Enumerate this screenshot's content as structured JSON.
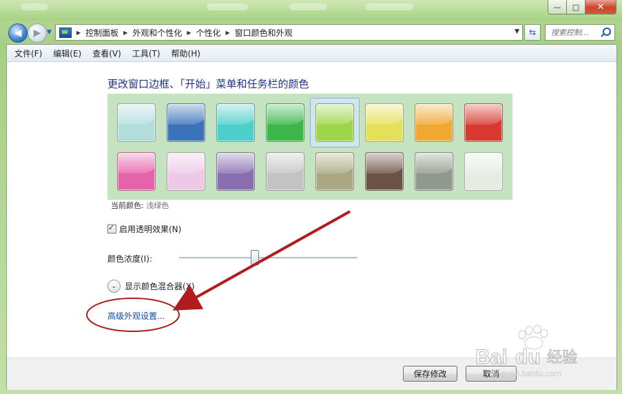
{
  "window": {
    "caption_buttons": {
      "minimize": "—",
      "maximize": "□",
      "close": "✕"
    }
  },
  "address": {
    "breadcrumbs": [
      "控制面板",
      "外观和个性化",
      "个性化",
      "窗口颜色和外观"
    ],
    "search_placeholder": "搜索控制..."
  },
  "icons": {
    "back": "back-arrow-icon",
    "forward": "forward-arrow-icon",
    "refresh": "refresh-icon",
    "search": "search-icon",
    "control_panel": "control-panel-icon",
    "expand": "chevron-down-icon"
  },
  "menu": [
    "文件(F)",
    "编辑(E)",
    "查看(V)",
    "工具(T)",
    "帮助(H)"
  ],
  "main": {
    "heading": "更改窗口边框、「开始」菜单和任务栏的颜色",
    "swatches": [
      {
        "color": "#b3dcdc"
      },
      {
        "color": "#3a73b8"
      },
      {
        "color": "#4dcfcb"
      },
      {
        "color": "#3cb549"
      },
      {
        "color": "#9ed64a",
        "selected": true
      },
      {
        "color": "#e5e05a"
      },
      {
        "color": "#f0a832"
      },
      {
        "color": "#d93a30"
      },
      {
        "color": "#e563a8"
      },
      {
        "color": "#ecc9e6"
      },
      {
        "color": "#8a6fb0"
      },
      {
        "color": "#c3c3c3"
      },
      {
        "color": "#a9a882"
      },
      {
        "color": "#6b5246"
      },
      {
        "color": "#8f9a8c"
      },
      {
        "color": "#e6ebe3"
      }
    ],
    "current_color_label": "当前颜色:",
    "current_color_value": "浅绿色",
    "transparency_label": "启用透明效果(N)",
    "transparency_checked": true,
    "intensity_label": "颜色浓度(I):",
    "intensity_value": 0.42,
    "mixer_label": "显示颜色混合器(X)",
    "advanced_link": "高级外观设置..."
  },
  "footer": {
    "save": "保存修改",
    "cancel": "取消"
  },
  "annotation": {
    "color": "#b01c1c"
  },
  "watermark": {
    "brand": "Bai",
    "brand_tail": "du",
    "suffix": "经验",
    "url": "jingyan.baidu.com"
  }
}
